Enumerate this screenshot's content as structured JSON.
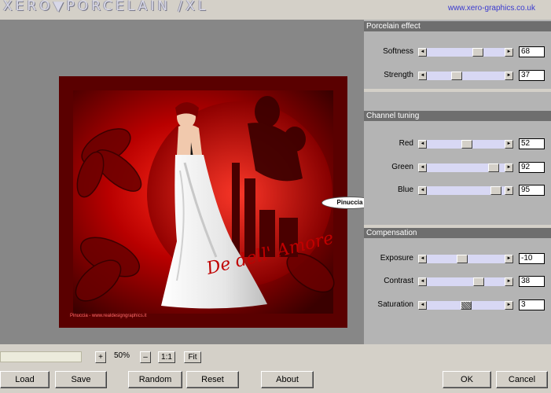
{
  "header": {
    "title": "XERO▼PORCELAIN /XL",
    "site": "www.xero-graphics.co.uk"
  },
  "preview": {
    "caption": "Pinuccia - www.realdesigngraphics.it",
    "badge": "Pinuccia"
  },
  "sections": {
    "porcelain": {
      "title": "Porcelain effect",
      "sliders": [
        {
          "label": "Softness",
          "value": "68",
          "fraction": 0.68
        },
        {
          "label": "Strength",
          "value": "37",
          "fraction": 0.37
        }
      ]
    },
    "channel": {
      "title": "Channel tuning",
      "sliders": [
        {
          "label": "Red",
          "value": "52",
          "fraction": 0.52
        },
        {
          "label": "Green",
          "value": "92",
          "fraction": 0.92
        },
        {
          "label": "Blue",
          "value": "95",
          "fraction": 0.95
        }
      ]
    },
    "compensation": {
      "title": "Compensation",
      "sliders": [
        {
          "label": "Exposure",
          "value": "-10",
          "fraction": 0.45
        },
        {
          "label": "Contrast",
          "value": "38",
          "fraction": 0.69
        },
        {
          "label": "Saturation",
          "value": "3",
          "fraction": 0.51
        }
      ]
    }
  },
  "zoom": {
    "plus": "+",
    "value": "50%",
    "minus": "–",
    "one_to_one": "1:1",
    "fit": "Fit"
  },
  "buttons": {
    "load": "Load",
    "save": "Save",
    "random": "Random",
    "reset": "Reset",
    "about": "About",
    "ok": "OK",
    "cancel": "Cancel"
  },
  "colors": {
    "panel": "#b4b4b4",
    "section_header": "#6e6e6e",
    "track": "#d8d8f4",
    "preview_bg": "#878787",
    "accent_link": "#3a3ad0"
  },
  "icons": {
    "arrow_left": "◄",
    "arrow_right": "►"
  }
}
